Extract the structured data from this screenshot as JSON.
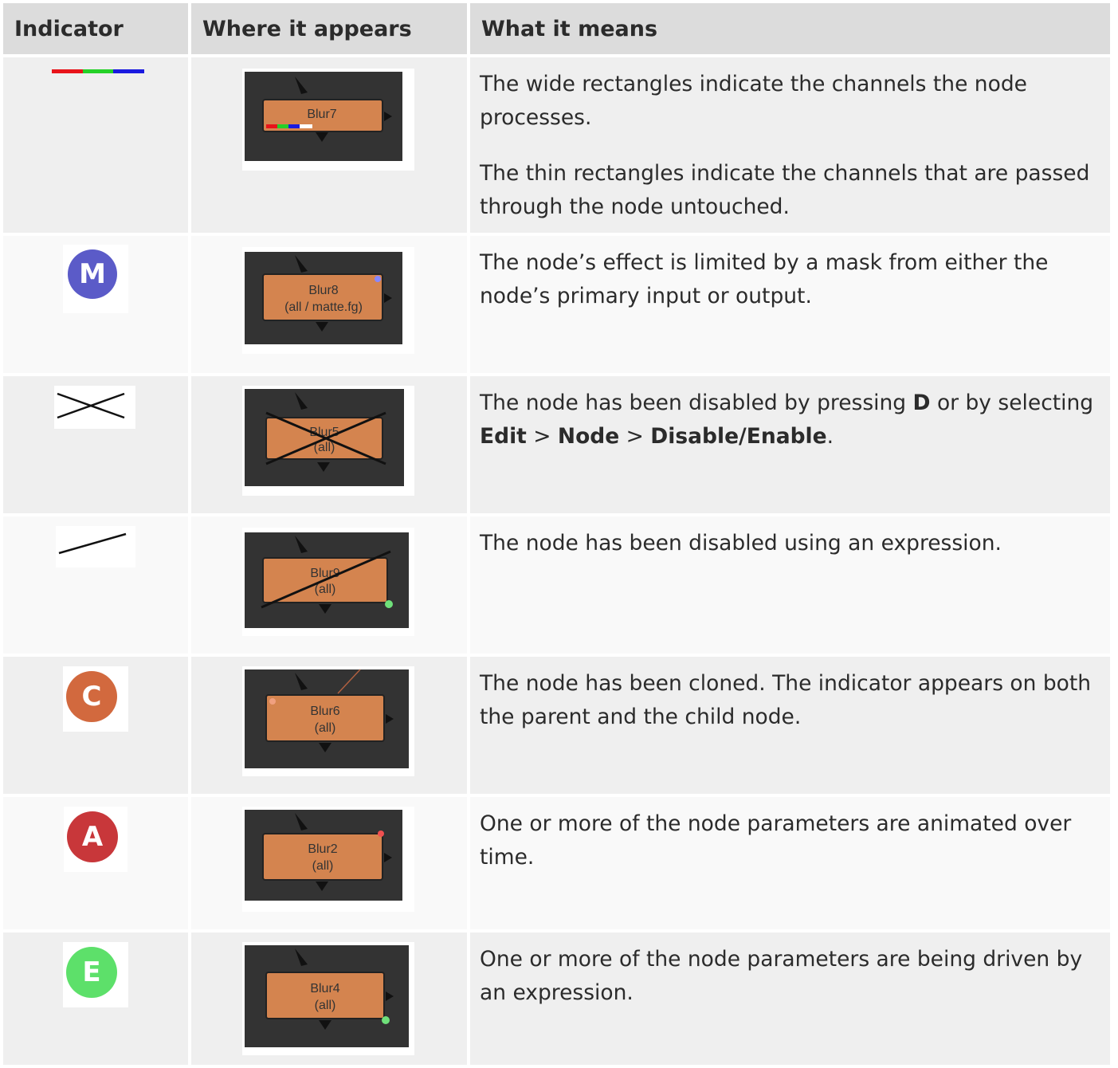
{
  "headers": {
    "indicator": "Indicator",
    "where": "Where it appears",
    "means": "What it means"
  },
  "rows": [
    {
      "icon": "rgb-channel-bars-icon",
      "node": {
        "name": "Blur7",
        "sub": ""
      },
      "means": [
        "The wide rectangles indicate the channels the node processes.",
        "The thin rectangles indicate the channels that are passed through the node untouched."
      ]
    },
    {
      "icon": "mask-m-icon",
      "badge_letter": "M",
      "badge_color": "#5b5bc8",
      "node": {
        "name": "Blur8",
        "sub": "(all / matte.fg)"
      },
      "means": [
        "The node’s effect is limited by a mask from either the node’s primary input or output."
      ]
    },
    {
      "icon": "disabled-cross-icon",
      "node": {
        "name": "Blur5",
        "sub": "(all)"
      },
      "means_parts": {
        "a": "The node has been disabled by pressing ",
        "key": "D",
        "b": " or by selecting ",
        "menu1": "Edit",
        "sep1": " > ",
        "menu2": "Node",
        "sep2": " > ",
        "menu3": "Disable/Enable",
        "end": "."
      }
    },
    {
      "icon": "disabled-expression-line-icon",
      "node": {
        "name": "Blur9",
        "sub": "(all)"
      },
      "means": [
        "The node has been disabled using an expression."
      ]
    },
    {
      "icon": "clone-c-icon",
      "badge_letter": "C",
      "badge_color": "#d2693e",
      "node": {
        "name": "Blur6",
        "sub": "(all)"
      },
      "means": [
        "The node has been cloned. The indicator appears on both the parent and the child node."
      ]
    },
    {
      "icon": "animated-a-icon",
      "badge_letter": "A",
      "badge_color": "#c8373a",
      "node": {
        "name": "Blur2",
        "sub": "(all)"
      },
      "means": [
        "One or more of the node parameters are animated over time."
      ]
    },
    {
      "icon": "expression-e-icon",
      "badge_letter": "E",
      "badge_color": "#5de06a",
      "node": {
        "name": "Blur4",
        "sub": "(all)"
      },
      "means": [
        "One or more of the node parameters are being driven by an expression."
      ]
    }
  ],
  "colors": {
    "node_fill": "#d4844f",
    "node_bg": "#333333",
    "red": "#e8141a",
    "green": "#25d128",
    "blue": "#1a1ae0"
  }
}
